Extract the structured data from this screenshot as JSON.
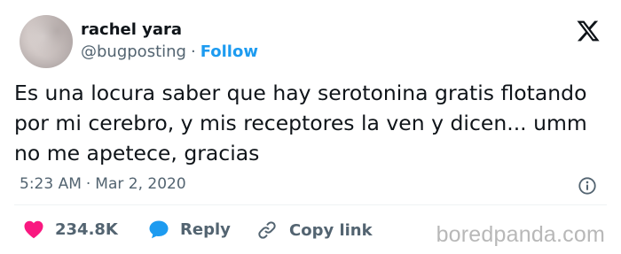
{
  "author": {
    "display_name": "rachel yara",
    "handle": "@bugposting",
    "separator": "·",
    "follow_label": "Follow",
    "avatar_icon": "avatar-photo"
  },
  "platform": {
    "logo_icon": "x-logo-icon"
  },
  "tweet": {
    "text": "Es una locura saber que hay serotonina gratis flotando\npor mi cerebro, y mis receptores la ven y dicen... umm\nno me apetece, gracias",
    "time": "5:23 AM",
    "separator": "·",
    "date": "Mar 2, 2020",
    "info_icon": "info-icon"
  },
  "actions": {
    "like": {
      "icon": "heart-icon",
      "count": "234.8K",
      "color": "#f91880"
    },
    "reply": {
      "icon": "reply-icon",
      "label": "Reply",
      "color": "#1d9bf0"
    },
    "copy": {
      "icon": "link-icon",
      "label": "Copy link"
    }
  },
  "watermark": "boredpanda.com",
  "colors": {
    "accent": "#1d9bf0",
    "text_primary": "#0f1419",
    "text_secondary": "#536471",
    "like": "#f91880"
  }
}
